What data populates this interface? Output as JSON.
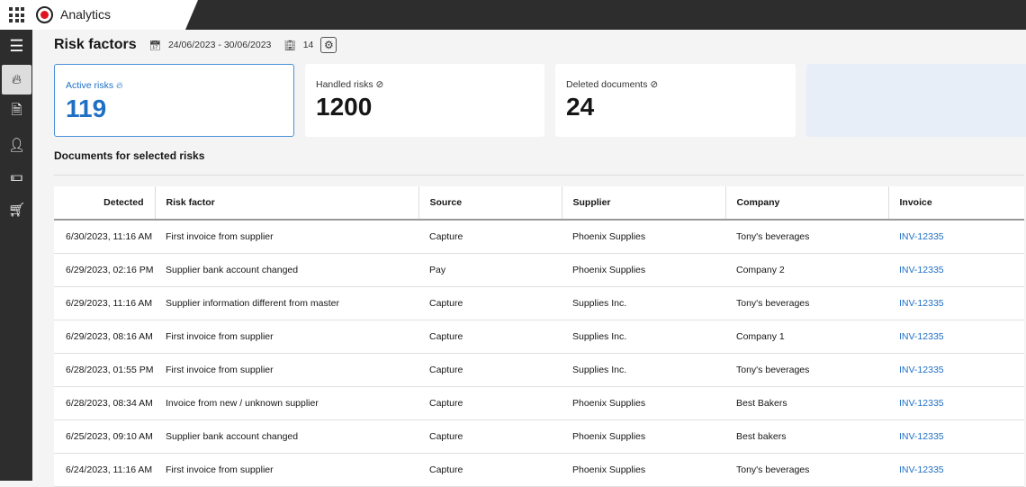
{
  "app": {
    "title": "Analytics"
  },
  "sidebar": {
    "items": [
      {
        "icon": "menu-icon"
      },
      {
        "icon": "flame-icon",
        "active": true
      },
      {
        "icon": "document-icon"
      },
      {
        "icon": "person-icon"
      },
      {
        "icon": "money-icon"
      },
      {
        "icon": "cart-icon"
      }
    ]
  },
  "header": {
    "title": "Risk factors",
    "date_range": "24/06/2023 - 30/06/2023",
    "company_count": "14"
  },
  "cards": [
    {
      "label": "Active risks",
      "value": "119"
    },
    {
      "label": "Handled risks",
      "value": "1200"
    },
    {
      "label": "Deleted documents",
      "value": "24"
    }
  ],
  "section": {
    "title": "Documents for selected risks"
  },
  "table": {
    "columns": [
      "Detected",
      "Risk factor",
      "Source",
      "Supplier",
      "Company",
      "Invoice"
    ],
    "rows": [
      [
        "6/30/2023, 11:16 AM",
        "First invoice from supplier",
        "Capture",
        "Phoenix Supplies",
        "Tony's beverages",
        "INV-12335"
      ],
      [
        "6/29/2023, 02:16 PM",
        "Supplier bank account changed",
        "Pay",
        "Phoenix Supplies",
        "Company 2",
        "INV-12335"
      ],
      [
        "6/29/2023, 11:16 AM",
        "Supplier information different from master",
        "Capture",
        "Supplies Inc.",
        "Tony's beverages",
        "INV-12335"
      ],
      [
        "6/29/2023, 08:16 AM",
        "First invoice from supplier",
        "Capture",
        "Supplies Inc.",
        "Company 1",
        "INV-12335"
      ],
      [
        "6/28/2023, 01:55 PM",
        "First invoice from supplier",
        "Capture",
        "Supplies Inc.",
        "Tony's beverages",
        "INV-12335"
      ],
      [
        "6/28/2023, 08:34 AM",
        "Invoice from new / unknown supplier",
        "Capture",
        "Phoenix Supplies",
        "Best Bakers",
        "INV-12335"
      ],
      [
        "6/25/2023, 09:10 AM",
        "Supplier bank account changed",
        "Capture",
        "Phoenix Supplies",
        "Best bakers",
        "INV-12335"
      ],
      [
        "6/24/2023, 11:16 AM",
        "First invoice from supplier",
        "Capture",
        "Phoenix Supplies",
        "Tony's beverages",
        "INV-12335"
      ]
    ]
  }
}
